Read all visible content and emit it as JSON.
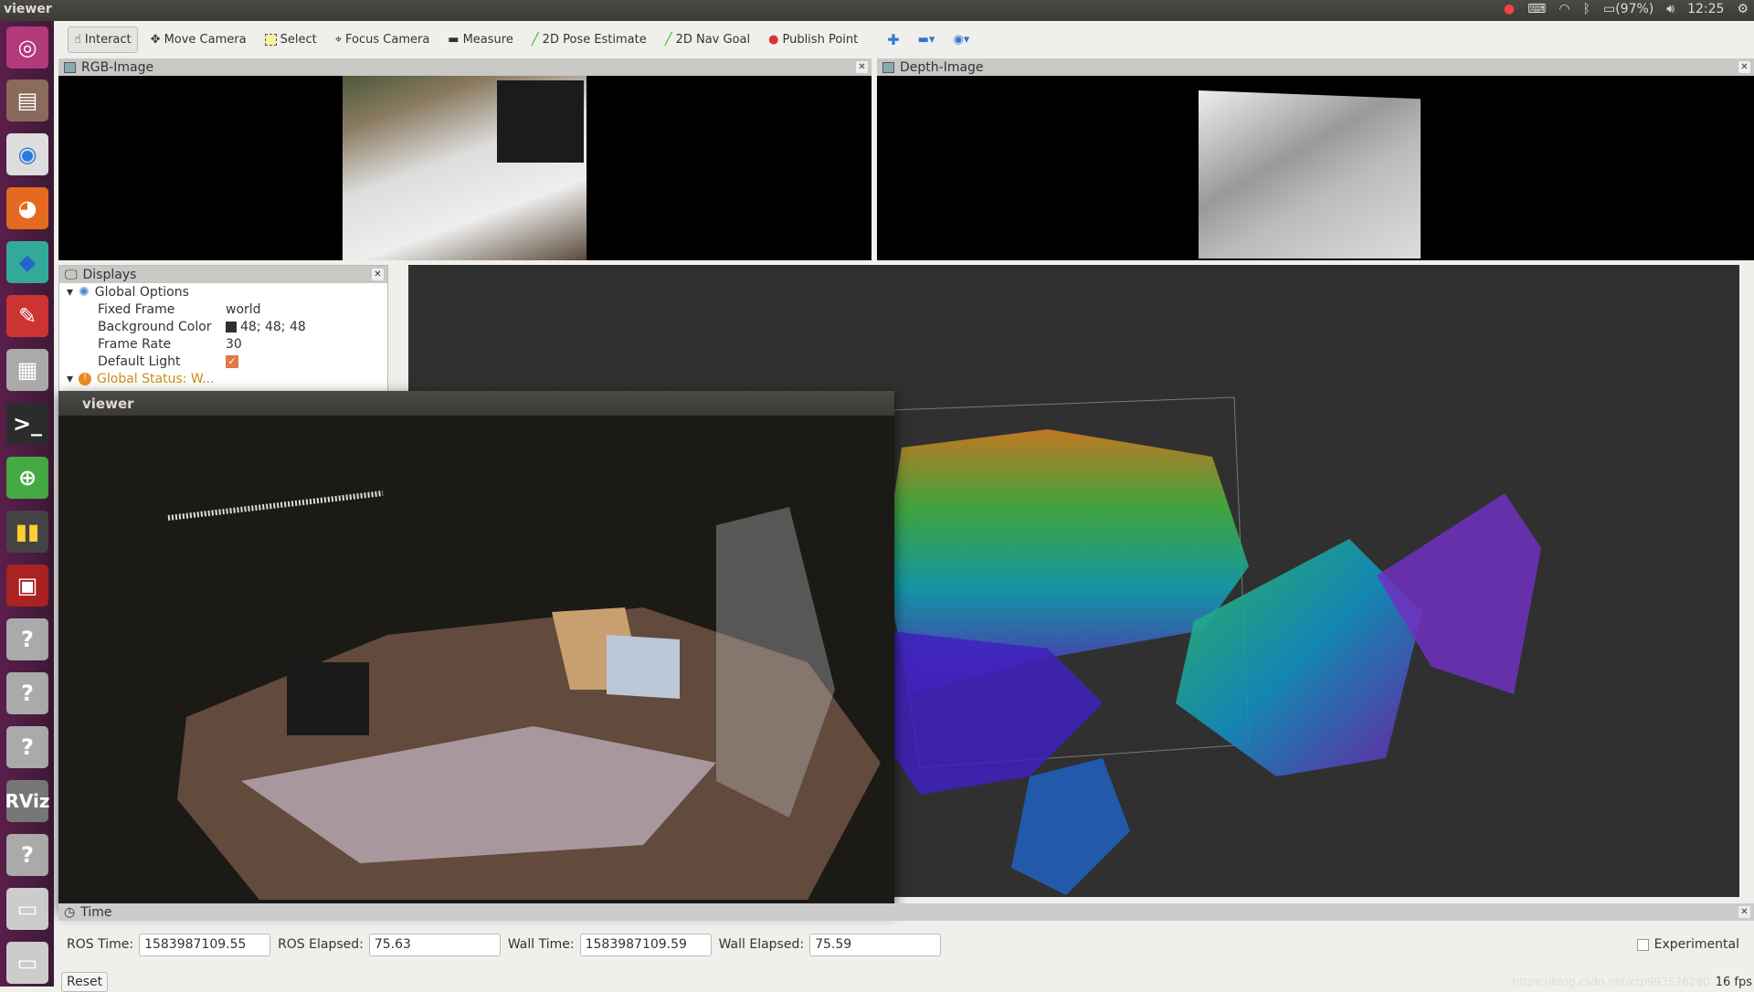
{
  "topbar": {
    "title": "viewer",
    "battery": "(97%)",
    "clock": "12:25"
  },
  "launcher": {
    "items": [
      "ubuntu-dash",
      "files",
      "chrome",
      "firefox",
      "app",
      "settings",
      "video",
      "terminal",
      "screenshot",
      "colors",
      "presentation",
      "unknown",
      "unknown",
      "unknown",
      "RViz",
      "unknown",
      "drive",
      "drive"
    ],
    "rviz_label": "RViz",
    "unknown_label": "?"
  },
  "toolbar": {
    "tools": [
      {
        "label": "Interact",
        "icon": "hand-icon",
        "active": true
      },
      {
        "label": "Move Camera",
        "icon": "move-icon"
      },
      {
        "label": "Select",
        "icon": "select-icon"
      },
      {
        "label": "Focus Camera",
        "icon": "focus-icon"
      },
      {
        "label": "Measure",
        "icon": "ruler-icon"
      },
      {
        "label": "2D Pose Estimate",
        "icon": "green-arrow-icon"
      },
      {
        "label": "2D Nav Goal",
        "icon": "green-arrow-icon"
      },
      {
        "label": "Publish Point",
        "icon": "pin-icon"
      }
    ]
  },
  "panels": {
    "rgb_title": "RGB-Image",
    "depth_title": "Depth-Image",
    "displays_title": "Displays",
    "time_title": "Time"
  },
  "displays": {
    "global_options": "Global Options",
    "rows": [
      {
        "key": "Fixed Frame",
        "value": "world"
      },
      {
        "key": "Background Color",
        "value": "48; 48; 48",
        "swatch": "#303030"
      },
      {
        "key": "Frame Rate",
        "value": "30"
      },
      {
        "key": "Default Light",
        "value": "",
        "checked": true
      }
    ],
    "global_status": "Global Status: W..."
  },
  "viewer_window": {
    "title": "viewer"
  },
  "time": {
    "ros_time_label": "ROS Time:",
    "ros_time": "1583987109.55",
    "ros_elapsed_label": "ROS Elapsed:",
    "ros_elapsed": "75.63",
    "wall_time_label": "Wall Time:",
    "wall_time": "1583987109.59",
    "wall_elapsed_label": "Wall Elapsed:",
    "wall_elapsed": "75.59",
    "experimental_label": "Experimental",
    "reset_label": "Reset",
    "fps": "16 fps",
    "watermark": "https://blog.csdn.net/crp997576280"
  }
}
